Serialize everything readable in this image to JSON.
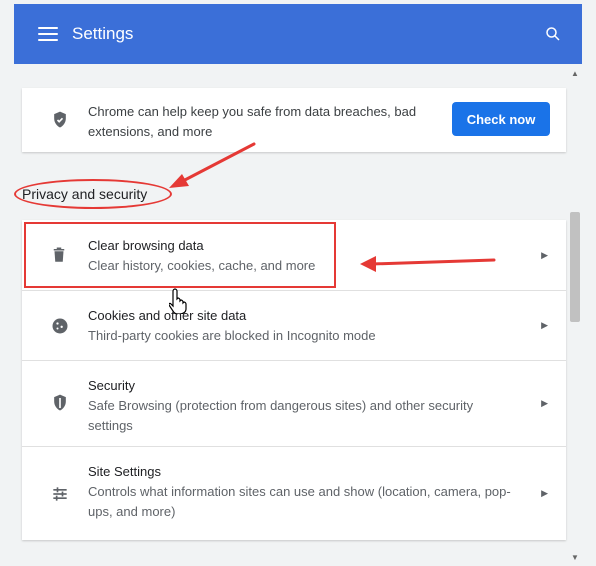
{
  "header": {
    "title": "Settings",
    "menu_icon": "hamburger-icon",
    "search_icon": "search-icon"
  },
  "safety_card": {
    "icon": "shield-icon",
    "text": "Chrome can help keep you safe from data breaches, bad extensions, and more",
    "button_label": "Check now"
  },
  "section": {
    "title": "Privacy and security"
  },
  "rows": [
    {
      "icon": "trash-icon",
      "title": "Clear browsing data",
      "subtitle": "Clear history, cookies, cache, and more"
    },
    {
      "icon": "cookie-icon",
      "title": "Cookies and other site data",
      "subtitle": "Third-party cookies are blocked in Incognito mode"
    },
    {
      "icon": "shield-icon",
      "title": "Security",
      "subtitle": "Safe Browsing (protection from dangerous sites) and other security settings"
    },
    {
      "icon": "tune-icon",
      "title": "Site Settings",
      "subtitle": "Controls what information sites can use and show (location, camera, pop-ups, and more)"
    }
  ],
  "colors": {
    "accent": "#3b6fd8",
    "button": "#1a73e8",
    "annotation": "#e53935"
  }
}
